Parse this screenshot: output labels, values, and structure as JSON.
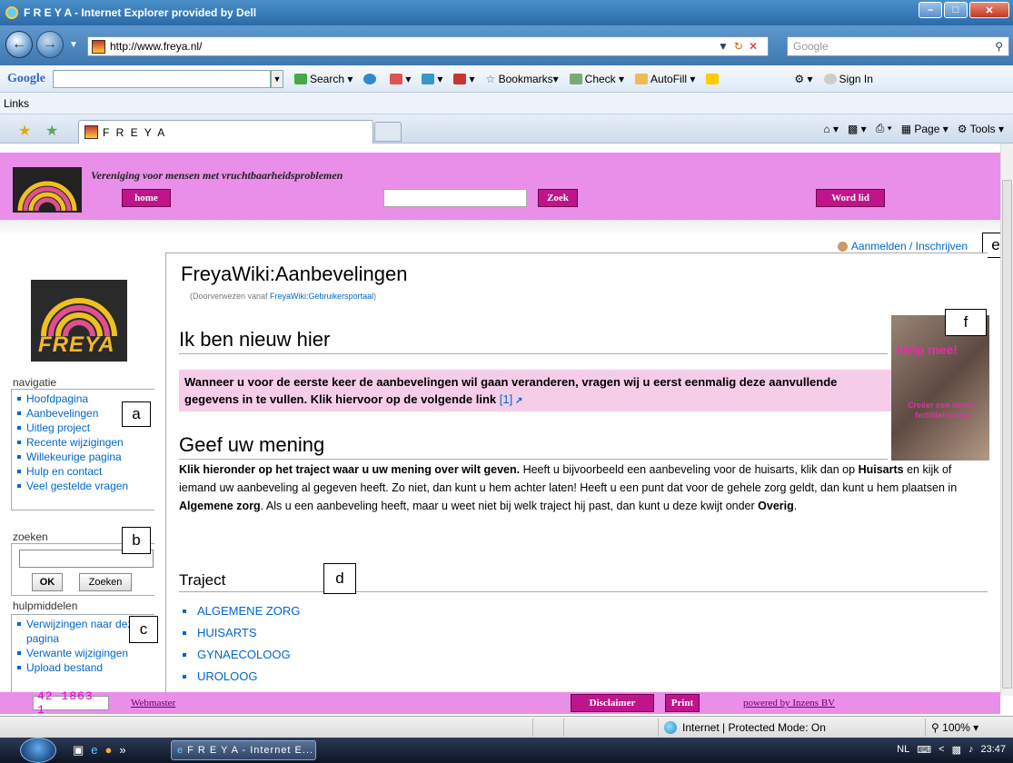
{
  "window": {
    "title": "F R E Y A - Internet Explorer provided by Dell",
    "address": "http://www.freya.nl/",
    "search_placeholder": "Google"
  },
  "google_toolbar": {
    "logo": "Google",
    "items": [
      "Search",
      "Bookmarks",
      "Check",
      "AutoFill",
      "Sign In"
    ]
  },
  "links_bar": {
    "label": "Links"
  },
  "tab": {
    "title": "F R E Y A"
  },
  "command_bar": {
    "page": "Page",
    "tools": "Tools"
  },
  "header": {
    "tagline": "Vereniging voor mensen met vruchtbaarheidsproblemen",
    "home_button": "home",
    "search_button": "Zoek",
    "join_button": "Word lid"
  },
  "login": {
    "label": "Aanmelden / Inschrijven"
  },
  "markers": {
    "a": "a",
    "b": "b",
    "c": "c",
    "d": "d",
    "e": "e",
    "f": "f"
  },
  "sidebar": {
    "logo_text": "FREYA",
    "nav_title": "navigatie",
    "nav_items": [
      "Hoofdpagina",
      "Aanbevelingen",
      "Uitleg project",
      "Recente wijzigingen",
      "Willekeurige pagina",
      "Hulp en contact",
      "Veel gestelde vragen"
    ],
    "search_title": "zoeken",
    "ok_button": "OK",
    "search_button": "Zoeken",
    "tools_title": "hulpmiddelen",
    "tools_items": [
      "Verwijzingen naar deze pagina",
      "Verwante wijzigingen",
      "Upload bestand"
    ]
  },
  "content": {
    "title": "FreyaWiki:Aanbevelingen",
    "redirect_prefix": "(Doorverwezen vanaf ",
    "redirect_link": "FreyaWiki:Gebruikersportaal",
    "redirect_suffix": ")",
    "section1_title": "Ik ben nieuw hier",
    "section1_text": "Wanneer u voor de eerste keer de aanbevelingen wil gaan veranderen, vragen wij u eerst eenmalig deze aanvullende gegevens in te vullen. Klik hiervoor op de volgende link",
    "section1_link": "[1]",
    "section2_title": "Geef uw mening",
    "section2_bold": "Klik hieronder op het traject waar u uw mening over wilt geven.",
    "section2_text1": " Heeft u bijvoorbeeld een aanbeveling voor de huisarts, klik dan op ",
    "section2_b2": "Huisarts",
    "section2_text2": " en kijk of iemand uw aanbeveling al gegeven heeft. Zo niet, dan kunt u hem achter laten! Heeft u een punt dat voor de gehele zorg geldt, dan kunt u hem plaatsen in ",
    "section2_b3": "Algemene zorg",
    "section2_text3": ". Als u een aanbeveling heeft, maar u weet niet bij welk traject hij past, dan kunt u deze kwijt onder ",
    "section2_b4": "Overig",
    "section2_text4": ".",
    "traject_title": "Traject",
    "traject_items": [
      "ALGEMENE ZORG",
      "HUISARTS",
      "GYNAECOLOOG",
      "UROLOOG"
    ],
    "help_title": "Help mee!",
    "help_sub": "Creëer een betere fertiliteitszorg"
  },
  "footer": {
    "counter": "42 1863 1",
    "webmaster": "Webmaster",
    "disclaimer": "Disclaimer",
    "print": "Print",
    "powered": "powered by Inzens BV"
  },
  "statusbar": {
    "zone": "Internet | Protected Mode: On",
    "zoom": "100%"
  },
  "taskbar": {
    "task": "F R E Y A - Internet E...",
    "lang": "NL",
    "time": "23:47"
  }
}
